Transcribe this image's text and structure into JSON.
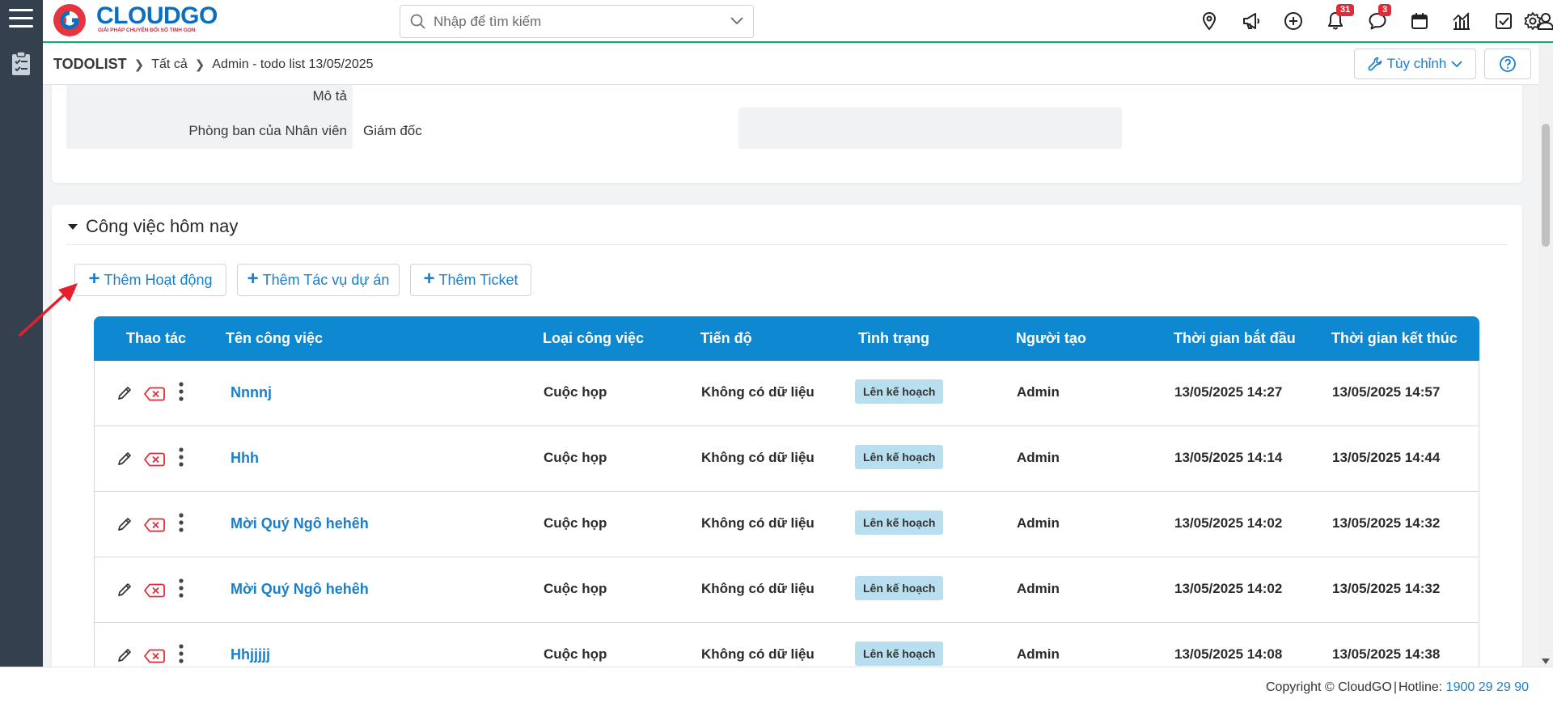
{
  "brand": {
    "name": "CLOUDGO",
    "tagline": "GIẢI PHÁP CHUYỂN ĐỔI SỐ TINH GỌN"
  },
  "search": {
    "placeholder": "Nhập để tìm kiếm"
  },
  "header_icons": {
    "notifications_count": "31",
    "messages_count": "3"
  },
  "breadcrumb": {
    "root": "TODOLIST",
    "level1": "Tất cả",
    "current": "Admin - todo list 13/05/2025"
  },
  "toolbar": {
    "customize_label": "Tùy chỉnh"
  },
  "details": {
    "description_label": "Mô tả",
    "department_label": "Phòng ban của Nhân viên",
    "department_value": "Giám đốc"
  },
  "today_tasks": {
    "title": "Công việc hôm nay",
    "add_activity": "Thêm Hoạt động",
    "add_project_task": "Thêm Tác vụ dự án",
    "add_ticket": "Thêm Ticket",
    "columns": [
      "Thao tác",
      "Tên công việc",
      "Loại công việc",
      "Tiến độ",
      "Tình trạng",
      "Người tạo",
      "Thời gian bắt đầu",
      "Thời gian kết thúc"
    ],
    "rows": [
      {
        "name": "Nnnnj",
        "type": "Cuộc họp",
        "progress": "Không có dữ liệu",
        "status": "Lên kế hoạch",
        "creator": "Admin",
        "start": "13/05/2025 14:27",
        "end": "13/05/2025 14:57"
      },
      {
        "name": "Hhh",
        "type": "Cuộc họp",
        "progress": "Không có dữ liệu",
        "status": "Lên kế hoạch",
        "creator": "Admin",
        "start": "13/05/2025 14:14",
        "end": "13/05/2025 14:44"
      },
      {
        "name": "Mời Quý Ngô hehêh",
        "type": "Cuộc họp",
        "progress": "Không có dữ liệu",
        "status": "Lên kế hoạch",
        "creator": "Admin",
        "start": "13/05/2025 14:02",
        "end": "13/05/2025 14:32"
      },
      {
        "name": "Mời Quý Ngô hehêh",
        "type": "Cuộc họp",
        "progress": "Không có dữ liệu",
        "status": "Lên kế hoạch",
        "creator": "Admin",
        "start": "13/05/2025 14:02",
        "end": "13/05/2025 14:32"
      },
      {
        "name": "Hhjjjjj",
        "type": "Cuộc họp",
        "progress": "Không có dữ liệu",
        "status": "Lên kế hoạch",
        "creator": "Admin",
        "start": "13/05/2025 14:08",
        "end": "13/05/2025 14:38"
      }
    ]
  },
  "footer": {
    "copyright": "Copyright © CloudGO",
    "hotline_label": "Hotline:",
    "hotline_number": "1900 29 29 90"
  },
  "colors": {
    "accent": "#1a7ec8",
    "table_header": "#0e88d0",
    "sidebar": "#34404e",
    "status_badge": "#b8dfef",
    "delete": "#e02b39"
  }
}
